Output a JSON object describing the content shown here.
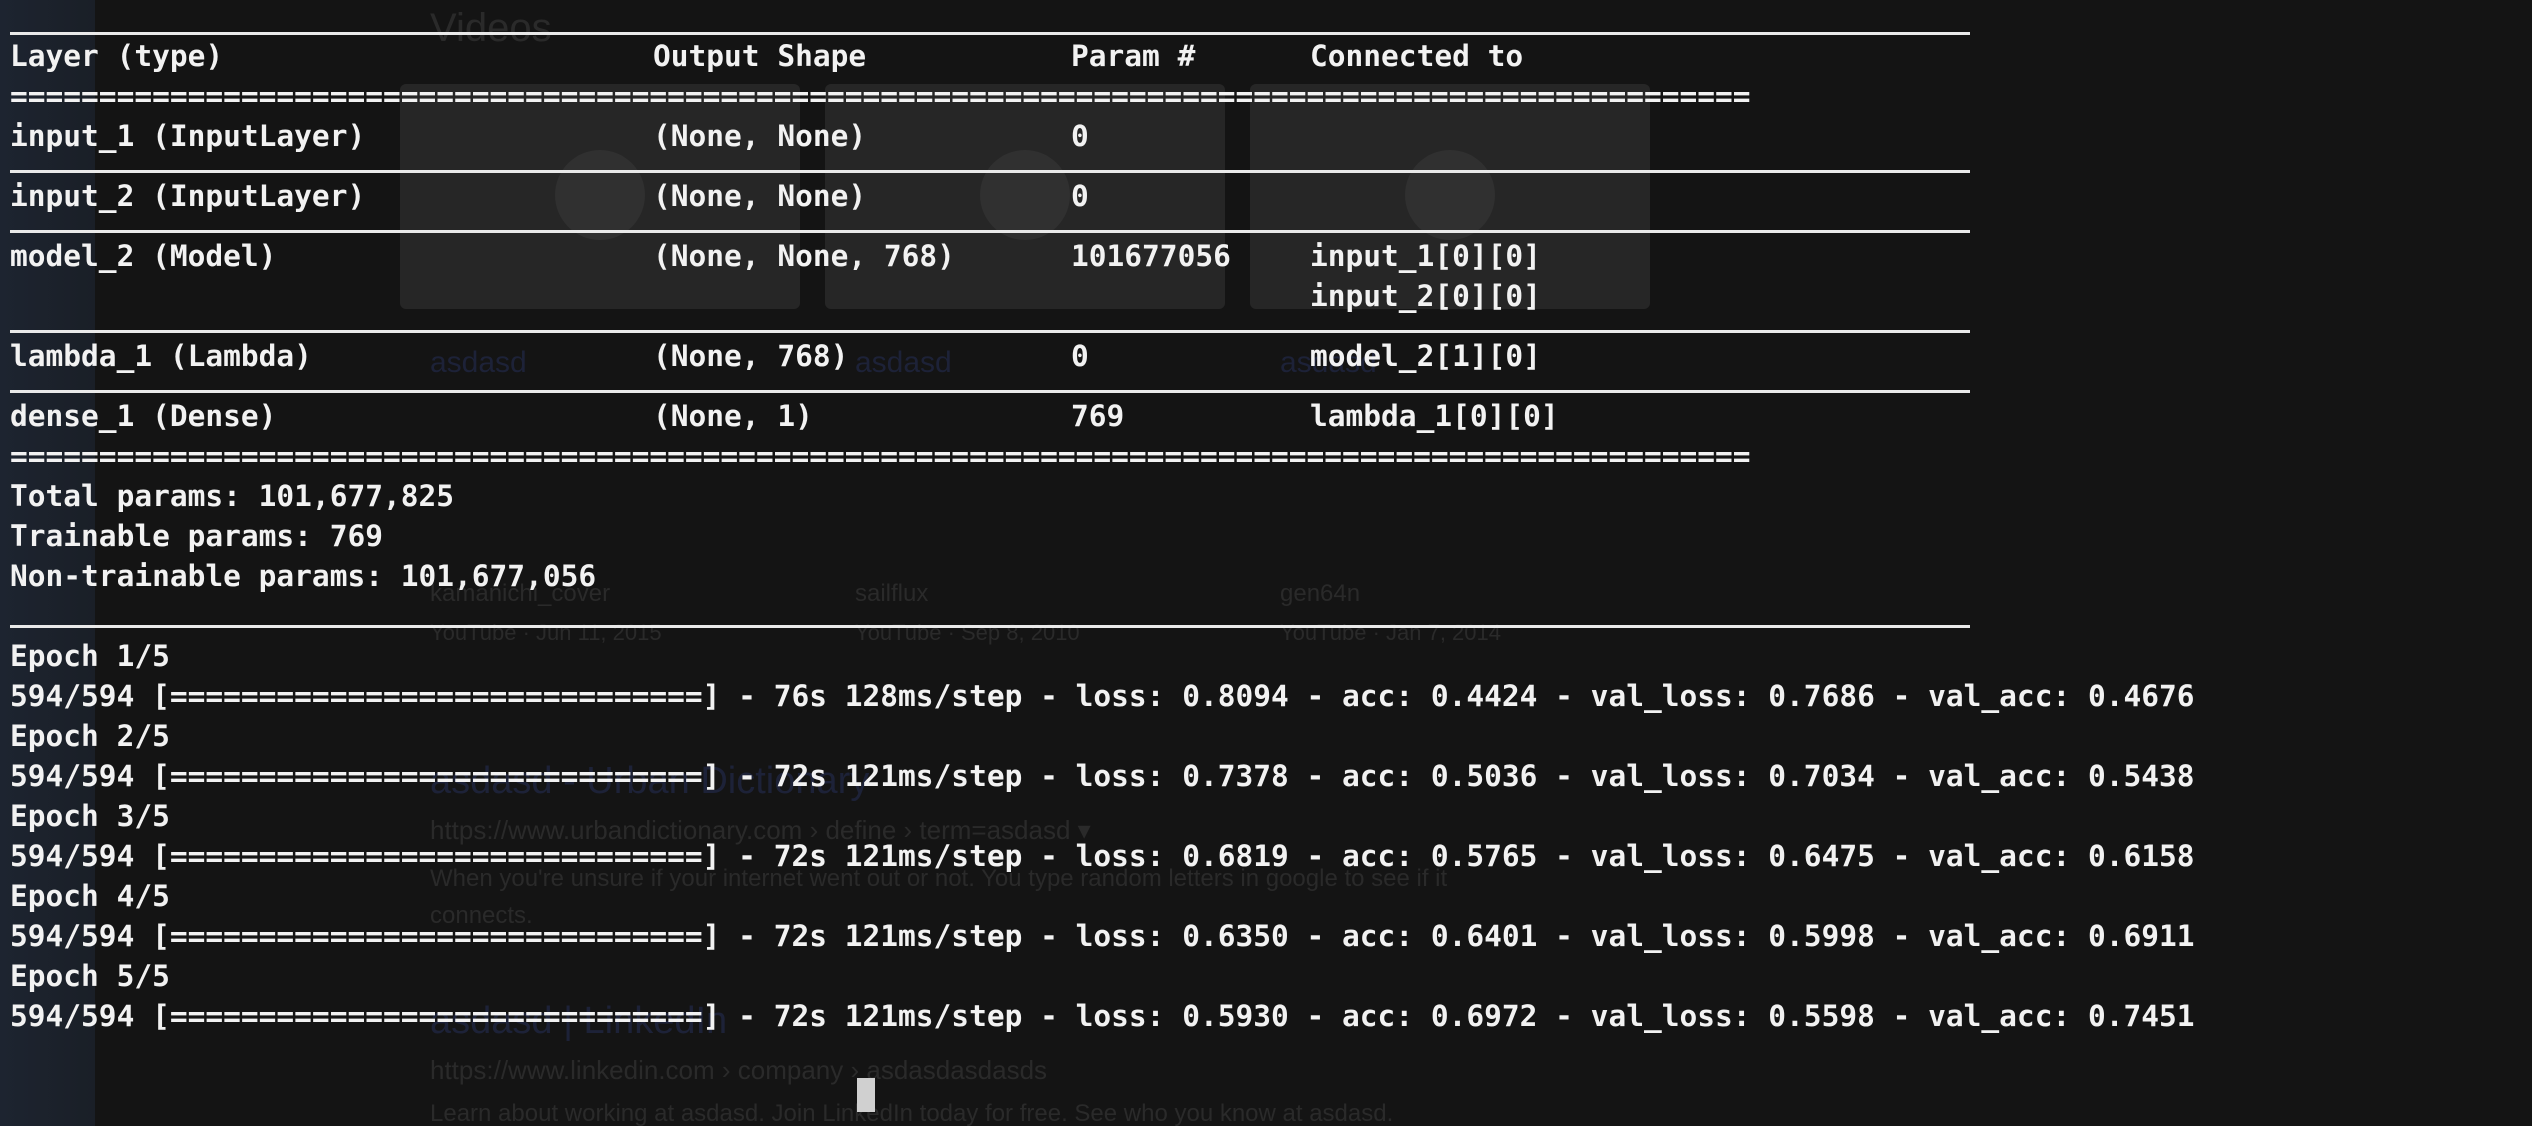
{
  "summary": {
    "headers": [
      "Layer (type)",
      "Output Shape",
      "Param #",
      "Connected to"
    ],
    "double_rule": "==================================================================================================",
    "layers": [
      {
        "name": "input_1 (InputLayer)",
        "output_shape": "(None, None)",
        "params": "0",
        "connected_to": [
          ""
        ]
      },
      {
        "name": "input_2 (InputLayer)",
        "output_shape": "(None, None)",
        "params": "0",
        "connected_to": [
          ""
        ]
      },
      {
        "name": "model_2 (Model)",
        "output_shape": "(None, None, 768)",
        "params": "101677056",
        "connected_to": [
          "input_1[0][0]",
          "input_2[0][0]"
        ]
      },
      {
        "name": "lambda_1 (Lambda)",
        "output_shape": "(None, 768)",
        "params": "0",
        "connected_to": [
          "model_2[1][0]"
        ]
      },
      {
        "name": "dense_1 (Dense)",
        "output_shape": "(None, 1)",
        "params": "769",
        "connected_to": [
          "lambda_1[0][0]"
        ]
      }
    ],
    "total_params": "Total params: 101,677,825",
    "trainable_params": "Trainable params: 769",
    "non_trainable_params": "Non-trainable params: 101,677,056"
  },
  "training": {
    "epochs": [
      {
        "header": "Epoch 1/5",
        "progress": "594/594 [==============================] - 76s 128ms/step - loss: 0.8094 - acc: 0.4424 - val_loss: 0.7686 - val_acc: 0.4676"
      },
      {
        "header": "Epoch 2/5",
        "progress": "594/594 [==============================] - 72s 121ms/step - loss: 0.7378 - acc: 0.5036 - val_loss: 0.7034 - val_acc: 0.5438"
      },
      {
        "header": "Epoch 3/5",
        "progress": "594/594 [==============================] - 72s 121ms/step - loss: 0.6819 - acc: 0.5765 - val_loss: 0.6475 - val_acc: 0.6158"
      },
      {
        "header": "Epoch 4/5",
        "progress": "594/594 [==============================] - 72s 121ms/step - loss: 0.6350 - acc: 0.6401 - val_loss: 0.5998 - val_acc: 0.6911"
      },
      {
        "header": "Epoch 5/5",
        "progress": "594/594 [==============================] - 72s 121ms/step - loss: 0.5930 - acc: 0.6972 - val_loss: 0.5598 - val_acc: 0.7451"
      }
    ]
  },
  "background_page": {
    "section_title": "Videos",
    "video_titles": [
      "asdasd",
      "asdasd",
      "asdasd"
    ],
    "video_channels": [
      "kamanichi_cover",
      "sailflux",
      "gen64n"
    ],
    "video_sources": [
      "YouTube · Jun 11, 2015",
      "YouTube · Sep 8, 2010",
      "YouTube · Jan 7, 2014"
    ],
    "result1_title": "asdasd - Urban Dictionary",
    "result1_url": "https://www.urbandictionary.com › define › term=asdasd ▾",
    "result1_snippet_1": "When you're unsure if your internet went out or not. You type random letters in google to see if it",
    "result1_snippet_2": "connects.",
    "result2_title": "asdasd | LinkedIn",
    "result2_url": "https://www.linkedin.com › company › asdasdasdasds",
    "result2_snippet": "Learn about working at asdasd. Join LinkedIn today for free. See who you know at asdasd."
  }
}
